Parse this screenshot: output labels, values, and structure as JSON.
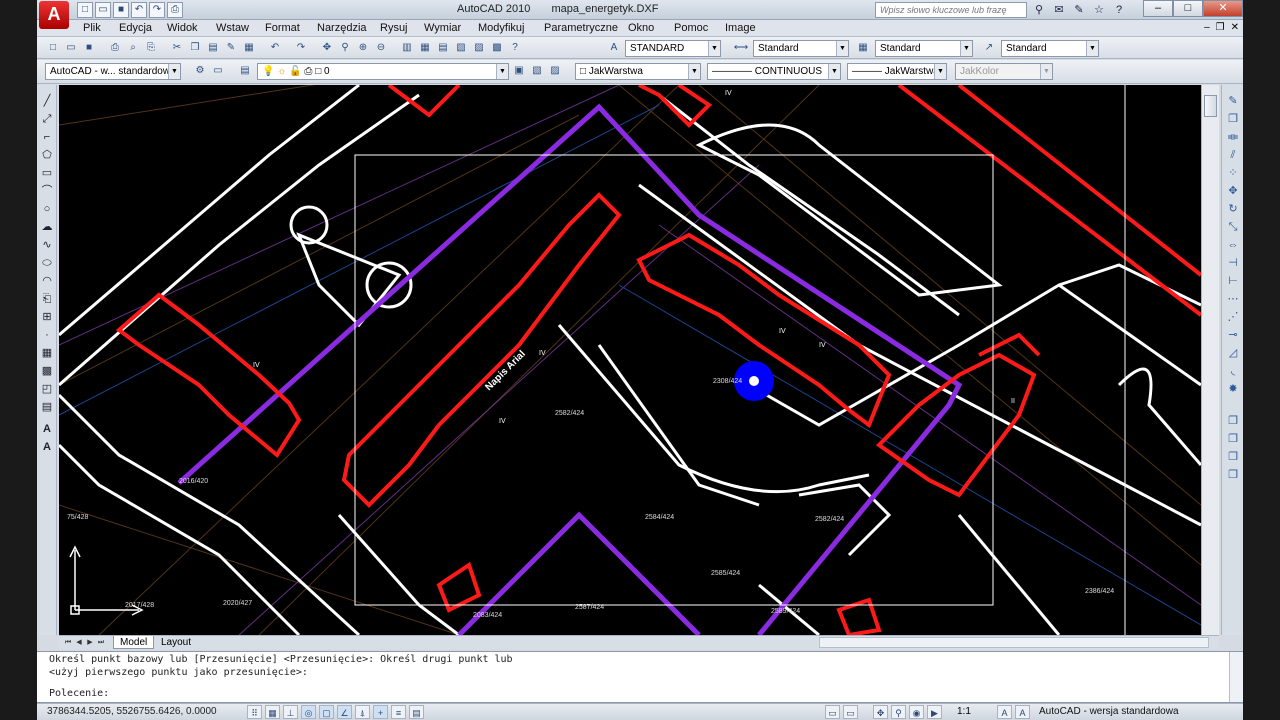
{
  "window": {
    "app_name": "AutoCAD 2010",
    "file_name": "mapa_energetyk.DXF",
    "search_placeholder": "Wpisz słowo kluczowe lub frazę",
    "logo_letter": "A"
  },
  "menu": [
    "Plik",
    "Edycja",
    "Widok",
    "Wstaw",
    "Format",
    "Narzędzia",
    "Rysuj",
    "Wymiar",
    "Modyfikuj",
    "Parametryczne",
    "Okno",
    "Pomoc",
    "Image"
  ],
  "toolbar_styles": {
    "text_style": "STANDARD",
    "dim_style": "Standard",
    "table_style": "Standard",
    "mleader_style": "Standard"
  },
  "toolbar_layers": {
    "workspace": "AutoCAD - w... standardowa",
    "layer": "0",
    "color": "JakWarstwa",
    "linetype": "CONTINUOUS",
    "lineweight": "JakWarstwa",
    "plotstyle": "JakKolor"
  },
  "drawing": {
    "label_napis": "Napis Arial",
    "parcel_labels": [
      "2308/424",
      "2582/424",
      "2584/424",
      "2585/424",
      "2587/424",
      "2589/424",
      "2582/424",
      "2017/428",
      "2020/427",
      "2083/424",
      "2386/424",
      "75/428",
      "2016/420"
    ],
    "building_labels": [
      "IV",
      "IV",
      "IV",
      "IV",
      "IV",
      "II",
      "IV"
    ]
  },
  "tabs": {
    "model": "Model",
    "layout": "Layout"
  },
  "command_line": {
    "line1": "Określ punkt bazowy lub [Przesunięcie] <Przesunięcie>: Określ drugi punkt lub",
    "line2": "<użyj pierwszego punktu jako przesunięcie>:",
    "prompt": "Polecenie:"
  },
  "status": {
    "coordinates": "3786344.5205, 5526755.6426, 0.0000",
    "scale": "1:1",
    "workspace": "AutoCAD - wersja standardowa"
  },
  "colors": {
    "background": "#000000",
    "building_outline": "#ff1a1a",
    "boundary": "#8a2be2",
    "white_lines": "#ffffff",
    "cursor_marker": "#0000ff"
  }
}
